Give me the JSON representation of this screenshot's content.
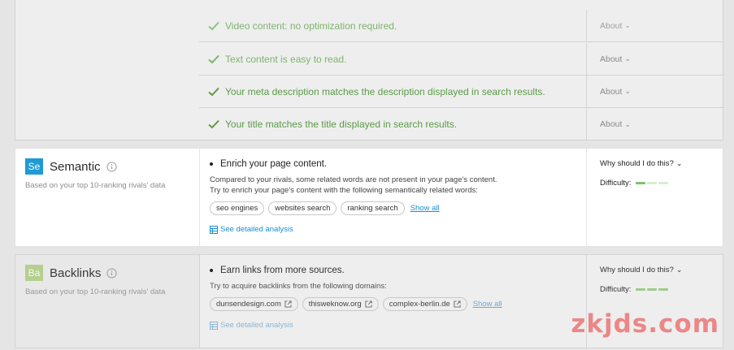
{
  "checks": [
    {
      "text": "Video content: no optimization required.",
      "about": "About"
    },
    {
      "text": "Text content is easy to read.",
      "about": "About"
    },
    {
      "text": "Your meta description matches the description displayed in search results.",
      "about": "About"
    },
    {
      "text": "Your title matches the title displayed in search results.",
      "about": "About"
    }
  ],
  "semantic": {
    "badge": "Se",
    "title": "Semantic",
    "subtitle": "Based on your top 10-ranking rivals' data",
    "task_title": "Enrich your page content.",
    "desc_line1": "Compared to your rivals, some related words are not present in your page's content.",
    "desc_line2": "Try to enrich your page's content with the following semantically related words:",
    "chips": [
      "seo engines",
      "websites search",
      "ranking search"
    ],
    "show_all": "Show all",
    "detail_link": "See detailed analysis",
    "why": "Why should I do this?",
    "difficulty_label": "Difficulty:",
    "difficulty_level": 1,
    "difficulty_max": 3
  },
  "backlinks": {
    "badge": "Ba",
    "title": "Backlinks",
    "subtitle": "Based on your top 10-ranking rivals' data",
    "task_title": "Earn links from more sources.",
    "desc_line1": "Try to acquire backlinks from the following domains:",
    "chips": [
      "dunsendesign.com",
      "thisweknow.org",
      "complex-berlin.de"
    ],
    "show_all": "Show all",
    "detail_link": "See detailed analysis",
    "why": "Why should I do this?",
    "difficulty_label": "Difficulty:",
    "difficulty_level": 3,
    "difficulty_max": 3
  },
  "watermark": "zkjds.com",
  "colors": {
    "accent_blue": "#1f9ad6",
    "check_green": "#5b9b48",
    "difficulty_green": "#7cc46a",
    "link_blue": "#1a8fd0"
  }
}
